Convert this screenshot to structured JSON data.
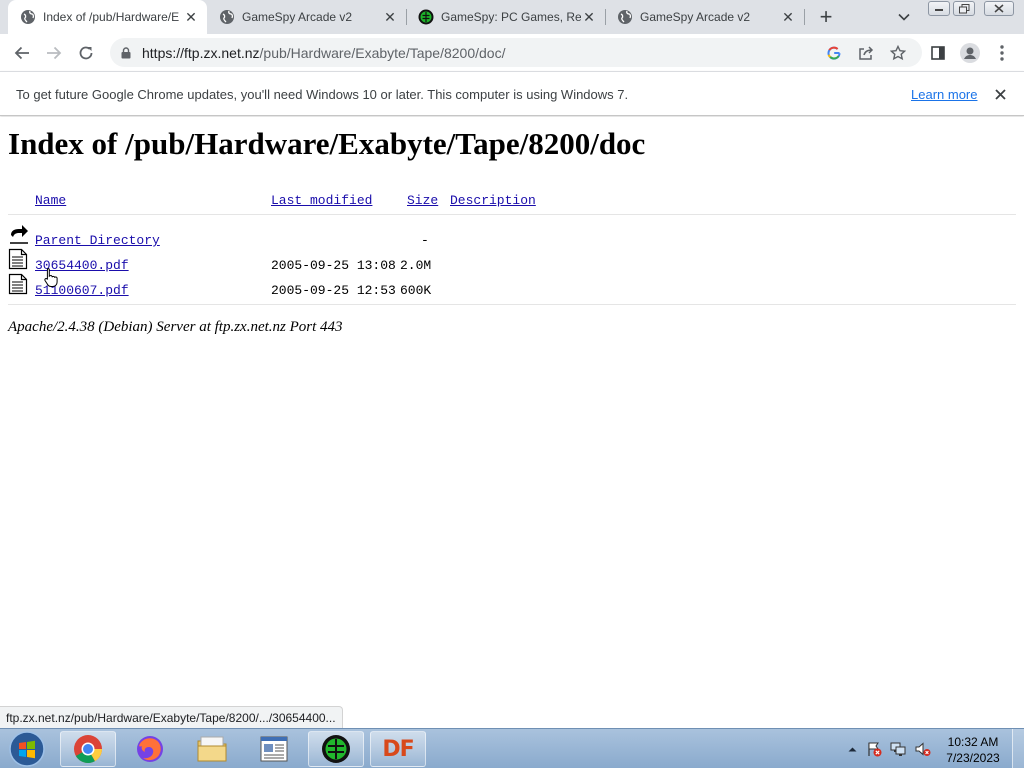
{
  "tabs": [
    {
      "title": "Index of /pub/Hardware/E",
      "active": true
    },
    {
      "title": "GameSpy Arcade v2",
      "active": false
    },
    {
      "title": "GameSpy: PC Games, Rev",
      "active": false
    },
    {
      "title": "GameSpy Arcade v2",
      "active": false
    }
  ],
  "toolbar": {
    "url_host": "https://ftp.zx.net.nz",
    "url_path": "/pub/Hardware/Exabyte/Tape/8200/doc/"
  },
  "infobar": {
    "message": "To get future Google Chrome updates, you'll need Windows 10 or later. This computer is using Windows 7.",
    "link": "Learn more"
  },
  "listing": {
    "heading": "Index of /pub/Hardware/Exabyte/Tape/8200/doc",
    "columns": {
      "name": "Name",
      "modified": "Last modified",
      "size": "Size",
      "description": "Description"
    },
    "parent": {
      "name": "Parent Directory",
      "size": "-"
    },
    "files": [
      {
        "name": "30654400.pdf",
        "modified": "2005-09-25 13:08",
        "size": "2.0M"
      },
      {
        "name": "51100607.pdf",
        "modified": "2005-09-25 12:53",
        "size": "600K"
      }
    ],
    "footer": "Apache/2.4.38 (Debian) Server at ftp.zx.net.nz Port 443"
  },
  "status_bubble": "ftp.zx.net.nz/pub/Hardware/Exabyte/Tape/8200/.../30654400...",
  "taskbar": {
    "apps": [
      "start-orb",
      "chrome",
      "firefox",
      "file-explorer",
      "document-viewer",
      "gamespy",
      "df"
    ],
    "df_label": "DF",
    "time": "10:32 AM",
    "date": "7/23/2023"
  }
}
